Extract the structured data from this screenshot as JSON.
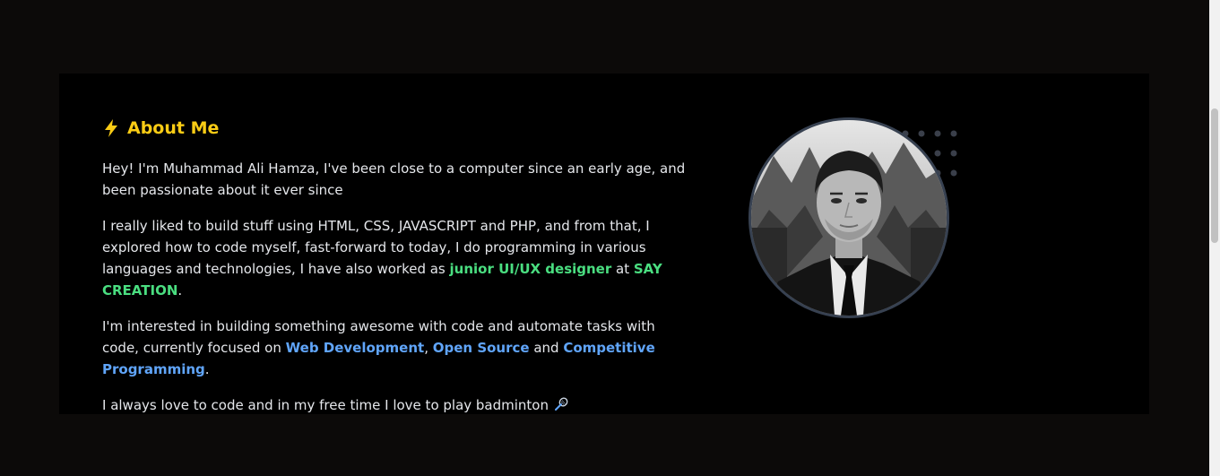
{
  "about": {
    "title": "About Me",
    "title_icon": "lightning-bolt-icon",
    "accent_color": "#facc15",
    "paragraphs": {
      "p1": "Hey! I'm Muhammad Ali Hamza, I've been close to a computer since an early age, and been passionate about it ever since",
      "p2_before": "I really liked to build stuff using HTML, CSS, JAVASCRIPT and PHP, and from that, I explored how to code myself, fast-forward to today, I do programming in various languages and technologies, I have also worked as ",
      "p2_role": "junior UI/UX designer",
      "p2_mid": " at ",
      "p2_company": "SAY CREATION",
      "p2_end": ".",
      "p3_before": "I'm interested in building something awesome with code and automate tasks with code, currently focused on ",
      "p3_focus1": "Web Development",
      "p3_sep1": ", ",
      "p3_focus2": "Open Source",
      "p3_sep2": " and ",
      "p3_focus3": "Competitive Programming",
      "p3_end": ".",
      "p4": "I always love to code and in my free time I love to play badminton",
      "p4_icon": "badminton-racket-icon"
    },
    "highlight_colors": {
      "green": "#4ade80",
      "blue": "#60a5fa"
    }
  },
  "profile": {
    "photo_icon": "profile-photo",
    "decoration": "dot-grid-decoration"
  }
}
